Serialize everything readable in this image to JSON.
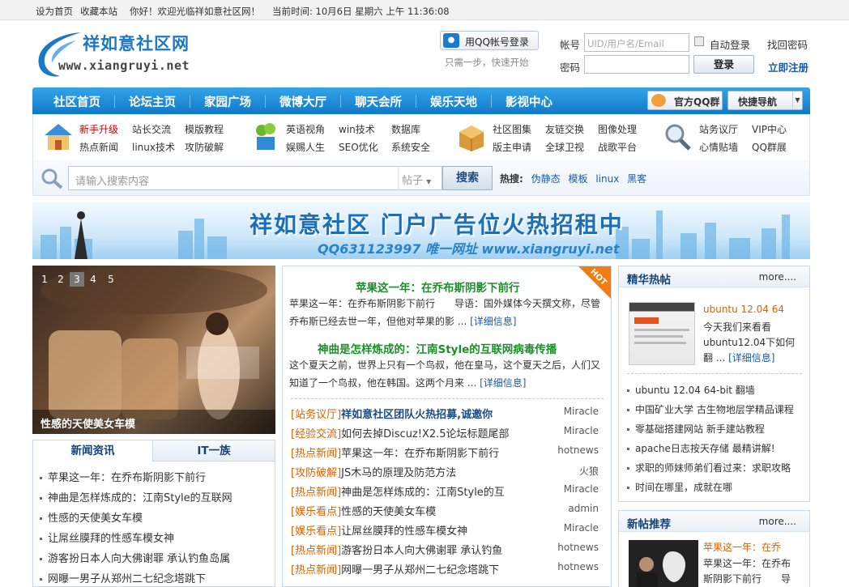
{
  "topbar": {
    "home": "设为首页",
    "fav": "收藏本站",
    "welcome": "你好！欢迎光临祥如意社区网！",
    "time": "当前时间: 10月6日 星期六 上午 11:36:08"
  },
  "logo": {
    "cn": "祥如意社区网",
    "en": "www.xiangruyi.net"
  },
  "login": {
    "qq_button": "用QQ帐号登录",
    "qq_sub": "只需一步，快速开始",
    "account_label": "帐号",
    "account_placeholder": "UID/用户名/Email",
    "auto_login": "自动登录",
    "find_pw": "找回密码",
    "password_label": "密码",
    "login_button": "登录",
    "register": "立即注册"
  },
  "nav": {
    "items": [
      "社区首页",
      "论坛主页",
      "家园广场",
      "微博大厅",
      "聊天会所",
      "娱乐天地",
      "影视中心"
    ],
    "qq_group": "官方QQ群",
    "quick_nav": "快捷导航"
  },
  "subnav": {
    "g1": [
      "新手升级",
      "站长交流",
      "模版教程",
      "热点新闻",
      "linux技术",
      "攻防破解"
    ],
    "g2": [
      "英语视角",
      "win技术",
      "数据库",
      "娱赐人生",
      "SEO优化",
      "系统安全"
    ],
    "g3": [
      "社区图集",
      "友链交换",
      "图像处理",
      "版主申请",
      "全球卫视",
      "战歌平台"
    ],
    "g4": [
      "站务议厅",
      "VIP中心",
      "心情贴墙",
      "QQ群展"
    ]
  },
  "search": {
    "placeholder": "请输入搜索内容",
    "type": "帖子",
    "button": "搜索",
    "hot_label": "热搜:",
    "hot": [
      "伪静态",
      "模板",
      "linux",
      "黑客"
    ]
  },
  "banner": {
    "title": "祥如意社区 门户广告位火热招租中",
    "sub": "QQ631123997  唯一网址 www.xiangruyi.net"
  },
  "slide": {
    "nums": [
      "1",
      "2",
      "3",
      "4",
      "5"
    ],
    "active": 2,
    "caption": "性感的天使美女车模"
  },
  "left_tabs": {
    "tabs": [
      "新闻资讯",
      "IT一族"
    ],
    "items": [
      "苹果这一年：在乔布斯阴影下前行",
      "神曲是怎样炼成的：江南Style的互联网",
      "性感的天使美女车模",
      "让屌丝膜拜的性感车模女神",
      "游客扮日本人向大佛谢罪 承认钓鱼岛属",
      "网曝一男子从郑州二七纪念塔跳下"
    ]
  },
  "middle": {
    "badge": "HOT",
    "a1": {
      "title": "苹果这一年：在乔布斯阴影下前行",
      "text": "苹果这一年：在乔布斯阴影下前行　　导语：国外媒体今天撰文称，尽管乔布斯已经去世一年，但他对苹果的影 ...",
      "more": "[详细信息]"
    },
    "a2": {
      "title": "神曲是怎样炼成的：江南Style的互联网病毒传播",
      "text": "这个夏天之前，世界上只有一个鸟叔，他在皇马，这个夏天之后，人们又知道了一个鸟叔，他在韩国。这两个月来 ...",
      "more": "[详细信息]"
    },
    "rows": [
      {
        "cat": "[站务议厅]",
        "title": "祥如意社区团队火热招募,诚邀你",
        "author": "Miracle",
        "hl": true
      },
      {
        "cat": "[经验交流]",
        "title": "如何去掉Discuz!X2.5论坛标题尾部",
        "author": "Miracle",
        "hl": false
      },
      {
        "cat": "[热点新闻]",
        "title": "苹果这一年：在乔布斯阴影下前行",
        "author": "hotnews",
        "hl": false
      },
      {
        "cat": "[攻防破解]",
        "title": "JS木马的原理及防范方法",
        "author": "火狼",
        "hl": false
      },
      {
        "cat": "[热点新闻]",
        "title": "神曲是怎样炼成的：江南Style的互",
        "author": "Miracle",
        "hl": false
      },
      {
        "cat": "[娱乐看点]",
        "title": "性感的天使美女车模",
        "author": "admin",
        "hl": false
      },
      {
        "cat": "[娱乐看点]",
        "title": "让屌丝膜拜的性感车模女神",
        "author": "Miracle",
        "hl": false
      },
      {
        "cat": "[热点新闻]",
        "title": "游客扮日本人向大佛谢罪 承认钓鱼",
        "author": "hotnews",
        "hl": false
      },
      {
        "cat": "[热点新闻]",
        "title": "网曝一男子从郑州二七纪念塔跳下",
        "author": "hotnews",
        "hl": false
      }
    ]
  },
  "right1": {
    "title": "精华热帖",
    "more": "more....",
    "feat_title": "ubuntu 12.04 64",
    "feat_l1": "今天我们来看看",
    "feat_l2": "ubuntu12.04下如何",
    "feat_l3": "翻 ...",
    "feat_more": "[详细信息]",
    "items": [
      "ubuntu 12.04 64-bit 翻墙",
      "中国矿业大学 古生物地层学精品课程",
      "零基础搭建网站 新手建站教程",
      "apache日志按天存储 最精讲解!",
      "求职的师妹师弟们看过来：求职攻略",
      "时间在哪里，成就在哪"
    ]
  },
  "right2": {
    "title": "新帖推荐",
    "more": "more....",
    "feat_title": "苹果这一年：在乔",
    "feat_l1": "苹果这一年：在乔布",
    "feat_l2": "斯阴影下前行　　导"
  }
}
